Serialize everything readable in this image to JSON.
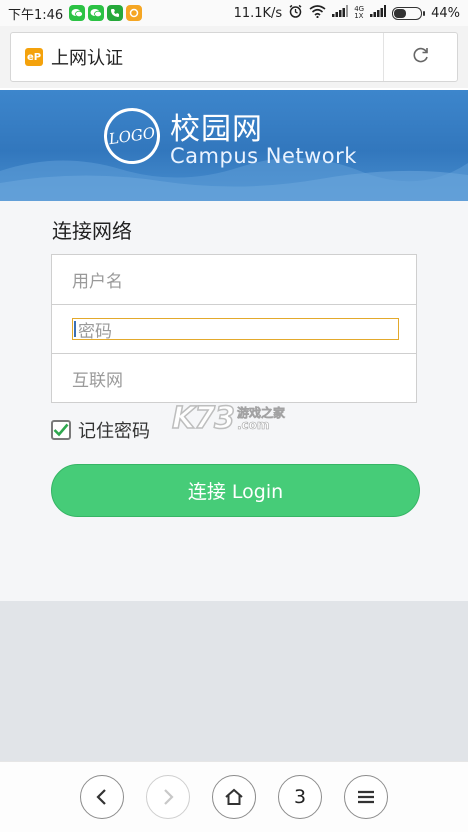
{
  "status_bar": {
    "time": "下午1:46",
    "net_speed": "11.1K/s",
    "signal_label_top": "4G",
    "signal_label_bottom": "1X",
    "battery": "44%",
    "battery_level": 0.44
  },
  "address_bar": {
    "site_icon_text": "eP",
    "page_title": "上网认证",
    "reload_icon": "reload-icon"
  },
  "banner": {
    "logo_text": "LOGO",
    "title_cn": "校园网",
    "title_en": "Campus Network",
    "colors": {
      "bg_top": "#3d86cc",
      "bg_bottom": "#4a90d0"
    }
  },
  "form": {
    "heading": "连接网络",
    "username_placeholder": "用户名",
    "password_placeholder": "密码",
    "provider_placeholder": "互联网",
    "remember_label": "记住密码",
    "remember_checked": true,
    "login_label": "连接 Login",
    "accent_color": "#46cc78"
  },
  "watermark": {
    "brand": "K73",
    "brand_cn": "游戏之家",
    "domain": ".com"
  },
  "bottom_nav": {
    "back_icon": "chevron-left-icon",
    "forward_icon": "chevron-right-icon",
    "home_icon": "home-icon",
    "tab_count": "3",
    "menu_icon": "menu-icon"
  }
}
